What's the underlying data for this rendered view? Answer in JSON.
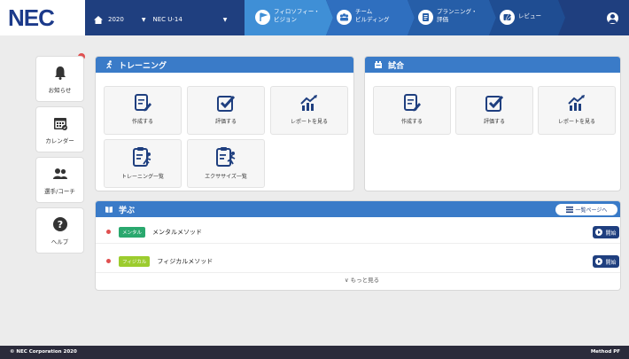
{
  "header": {
    "logo": "NEC",
    "year": "2020",
    "team": "NEC U-14",
    "steps": [
      {
        "label": "フィロソフィー・\nビジョン",
        "icon": "flag-icon"
      },
      {
        "label": "チーム\nビルディング",
        "icon": "team-icon"
      },
      {
        "label": "プランニング・\n評価",
        "icon": "planning-icon"
      },
      {
        "label": "レビュー",
        "icon": "review-icon"
      }
    ],
    "colors": {
      "header": "#1f3f7f",
      "step1": "#3f8fd6",
      "step2": "#2f6fbf",
      "step3": "#265ea8",
      "step4": "#1f4d92"
    }
  },
  "sidebar": {
    "items": [
      {
        "label": "お知らせ",
        "icon": "bell-icon"
      },
      {
        "label": "カレンダー",
        "icon": "calendar-icon"
      },
      {
        "label": "選手/コーチ",
        "icon": "players-icon"
      },
      {
        "label": "ヘルプ",
        "icon": "help-icon"
      }
    ]
  },
  "training": {
    "title": "トレーニング",
    "tiles": [
      {
        "label": "作成する",
        "icon": "create-icon"
      },
      {
        "label": "評価する",
        "icon": "evaluate-icon"
      },
      {
        "label": "レポートを見る",
        "icon": "report-icon"
      },
      {
        "label": "トレーニング一覧",
        "icon": "training-list-icon"
      },
      {
        "label": "エクササイズ一覧",
        "icon": "exercise-list-icon"
      }
    ]
  },
  "match": {
    "title": "試合",
    "tiles": [
      {
        "label": "作成する",
        "icon": "create-icon"
      },
      {
        "label": "評価する",
        "icon": "evaluate-icon"
      },
      {
        "label": "レポートを見る",
        "icon": "report-icon"
      }
    ]
  },
  "learn": {
    "title": "学ぶ",
    "list_button": "一覧ページへ",
    "rows": [
      {
        "tag": "メンタル",
        "tag_color": "#2aa86e",
        "title": "メンタルメソッド",
        "button": "開始"
      },
      {
        "tag": "フィジカル",
        "tag_color": "#9ccc2e",
        "title": "フィジカルメソッド",
        "button": "開始"
      }
    ],
    "more": "もっと見る"
  },
  "footer": {
    "copyright": "© NEC Corporation 2020",
    "brand": "Method PF"
  }
}
